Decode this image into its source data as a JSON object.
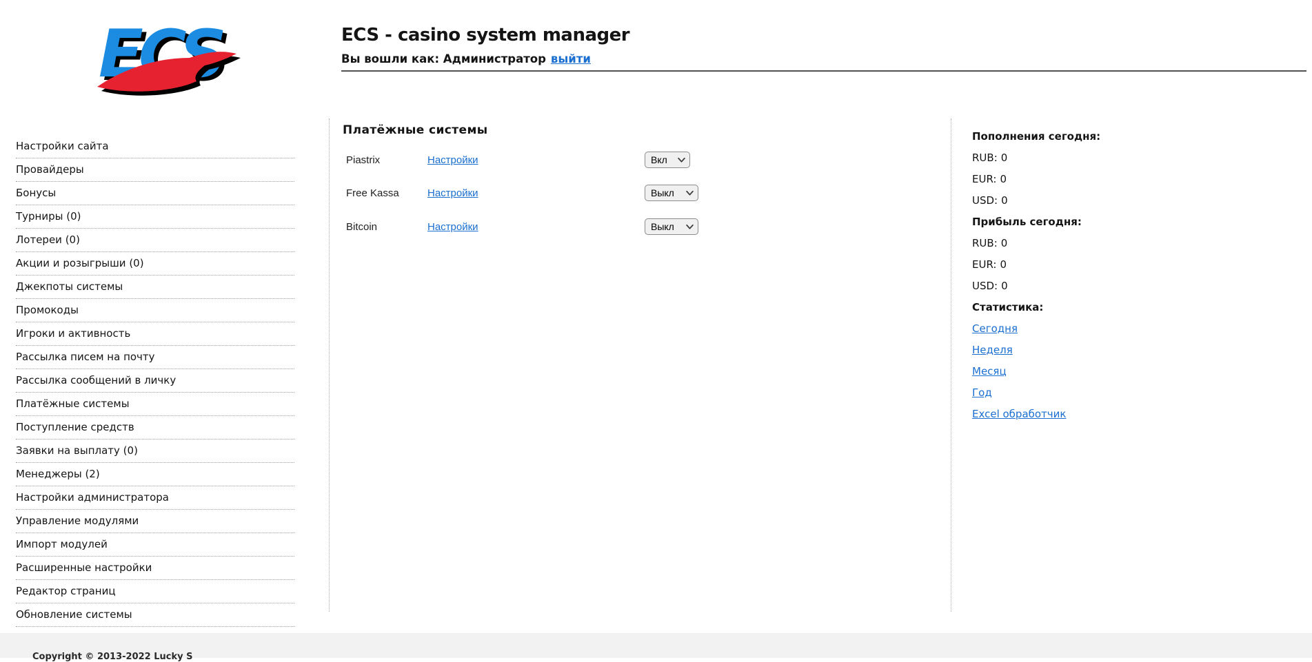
{
  "header": {
    "logo_text": "ECS",
    "title": "ECS - casino system manager",
    "login_label": "Вы вошли как: Администратор",
    "logout_link": "выйти"
  },
  "sidebar": {
    "items": [
      "Настройки сайта",
      "Провайдеры",
      "Бонусы",
      "Турниры (0)",
      "Лотереи (0)",
      "Акции и розыгрыши (0)",
      "Джекпоты системы",
      "Промокоды",
      "Игроки и активность",
      "Рассылка писем на почту",
      "Рассылка сообщений в личку",
      "Платёжные системы",
      "Поступление средств",
      "Заявки на выплату (0)",
      "Менеджеры (2)",
      "Настройки администратора",
      "Управление модулями",
      "Импорт модулей",
      "Расширенные настройки",
      "Редактор страниц",
      "Обновление системы"
    ]
  },
  "main": {
    "title": "Платёжные системы",
    "rows": [
      {
        "name": "Piastrix",
        "settings_link": "Настройки",
        "state": "Вкл"
      },
      {
        "name": "Free Kassa",
        "settings_link": "Настройки",
        "state": "Выкл"
      },
      {
        "name": "Bitcoin",
        "settings_link": "Настройки",
        "state": "Выкл"
      }
    ]
  },
  "stats": {
    "deposits_header": "Пополнения сегодня:",
    "deposits": [
      {
        "label": "RUB:",
        "value": "0"
      },
      {
        "label": "EUR:",
        "value": "0"
      },
      {
        "label": "USD:",
        "value": "0"
      }
    ],
    "profit_header": "Прибыль сегодня:",
    "profit": [
      {
        "label": "RUB:",
        "value": "0"
      },
      {
        "label": "EUR:",
        "value": "0"
      },
      {
        "label": "USD:",
        "value": "0"
      }
    ],
    "stats_header": "Статистика:",
    "links": [
      "Сегодня",
      "Неделя",
      "Месяц",
      "Год",
      "Excel обработчик"
    ]
  },
  "footer": {
    "copyright": "Copyright © 2013-2022 Lucky S"
  },
  "colors": {
    "logo_blue": "#1b8ce2",
    "logo_red": "#e62230",
    "link_blue": "#1a6fd0",
    "header_rule": "#515151",
    "dotted_line": "#a6a6a6",
    "footer_bg": "#f2f2f2",
    "select_bg": "#f0f0f0"
  }
}
